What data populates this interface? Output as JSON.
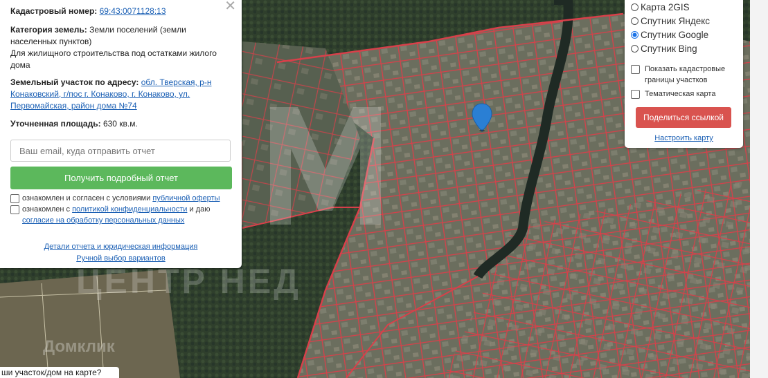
{
  "info": {
    "cadastral_label": "Кадастровый номер:",
    "cadastral_number": "69:43:0071128:13",
    "category_label": "Категория земель:",
    "category_value": "Земли поселений (земли населенных пунктов)",
    "purpose": "Для жилищного строительства под остатками жилого дома",
    "address_label": "Земельный участок по адресу:",
    "address_link": "обл. Тверская, р-н Конаковский, г/пос г. Конаково, г. Конаково, ул. Первомайская, район дома №74",
    "area_label": "Уточненная площадь:",
    "area_value": "630 кв.м."
  },
  "form": {
    "email_placeholder": "Ваш email, куда отправить отчет",
    "get_report_button": "Получить подробный отчет",
    "consent1_text": "ознакомлен и согласен с условиями",
    "consent1_link": "публичной оферты",
    "consent2_text": "ознакомлен с",
    "consent2_link": "политикой конфиденциальности",
    "consent2_text_after": "и даю",
    "consent2_link2": "согласие на обработку персональных данных"
  },
  "footer": {
    "details_link": "Детали отчета и юридическая информация",
    "manual_link": "Ручной выбор вариантов"
  },
  "layers": {
    "options": [
      "Карта 2GIS",
      "Спутник Яндекс",
      "Спутник Google",
      "Спутник Bing"
    ],
    "selected": "Спутник Google",
    "show_boundaries": "Показать кадастровые границы участков",
    "thematic": "Тематическая карта",
    "share_button": "Поделиться ссылкой",
    "configure_link": "Настроить карту"
  },
  "bottom_tip": "ши участок/дом на карте?",
  "watermarks": {
    "brand1": "ЦЕНТР НЕД",
    "brand2": "Домклик"
  },
  "colors": {
    "green": "#5cb85c",
    "red": "#d9534f",
    "link": "#1a5fb4",
    "boundary": "#d8404a"
  }
}
